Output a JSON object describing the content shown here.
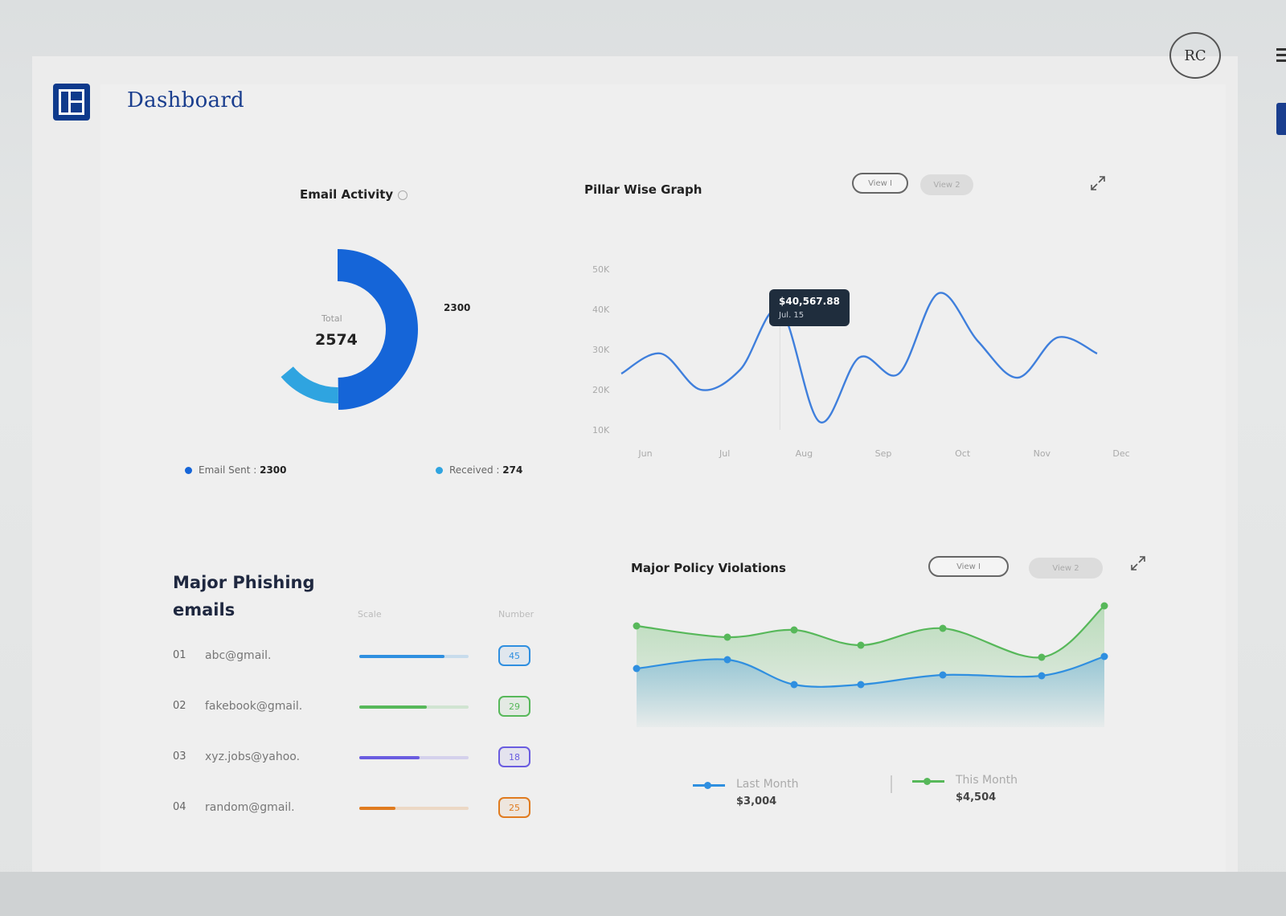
{
  "header": {
    "title": "Dashboard",
    "avatar_initials": "RC",
    "logo_icon": "layout-icon"
  },
  "email_activity": {
    "title": "Email Activity",
    "total_label": "Total",
    "total": "2574",
    "callout": "2300",
    "legend": [
      {
        "label": "Email Sent :",
        "value": "2300",
        "color": "#1565d8"
      },
      {
        "label": "Received :",
        "value": "274",
        "color": "#2fa4e0"
      }
    ],
    "chart_data": {
      "type": "pie",
      "categories": [
        "Email Sent",
        "Received"
      ],
      "values": [
        2300,
        274
      ]
    }
  },
  "pillar": {
    "title": "Pillar Wise Graph",
    "view1": "View I",
    "view2": "View 2",
    "tooltip_value": "$40,567.88",
    "tooltip_date": "Jul. 15",
    "chart_data": {
      "type": "line",
      "x": [
        "Jun",
        "",
        "Jul",
        "",
        "Aug",
        "",
        "Sep",
        "",
        "Oct",
        "",
        "Nov",
        "",
        "Dec"
      ],
      "series": [
        {
          "values": [
            24,
            29,
            20,
            25,
            40,
            12,
            28,
            24,
            44,
            32,
            23,
            33,
            29
          ]
        }
      ],
      "y_ticks": [
        "50K",
        "40K",
        "30K",
        "20K",
        "10K"
      ],
      "ylim": [
        10000,
        50000
      ],
      "grid": false
    }
  },
  "phishing": {
    "title": "Major Phishing emails",
    "col_scale": "Scale",
    "col_number": "Number",
    "rows": [
      {
        "idx": "01",
        "email": "abc@gmail.",
        "number": "45",
        "fraction": 0.78,
        "color": "#2f8fe0"
      },
      {
        "idx": "02",
        "email": "fakebook@gmail.",
        "number": "29",
        "fraction": 0.62,
        "color": "#57b85a"
      },
      {
        "idx": "03",
        "email": "xyz.jobs@yahoo.",
        "number": "18",
        "fraction": 0.55,
        "color": "#6a5ce0"
      },
      {
        "idx": "04",
        "email": "random@gmail.",
        "number": "25",
        "fraction": 0.33,
        "color": "#e07b1f"
      }
    ]
  },
  "policy": {
    "title": "Major Policy Violations",
    "view1": "View I",
    "view2": "View 2",
    "legend": [
      {
        "label": "Last Month",
        "amount": "$3,004",
        "color": "#2f8fe0"
      },
      {
        "label": "This Month",
        "amount": "$4,504",
        "color": "#57b85a"
      }
    ],
    "chart_data": {
      "type": "area",
      "series": [
        {
          "name": "Last Month",
          "values": [
            58,
            69,
            38,
            38,
            50,
            49,
            73
          ]
        },
        {
          "name": "This Month",
          "values": [
            111,
            97,
            106,
            87,
            108,
            72,
            136
          ]
        }
      ]
    }
  }
}
